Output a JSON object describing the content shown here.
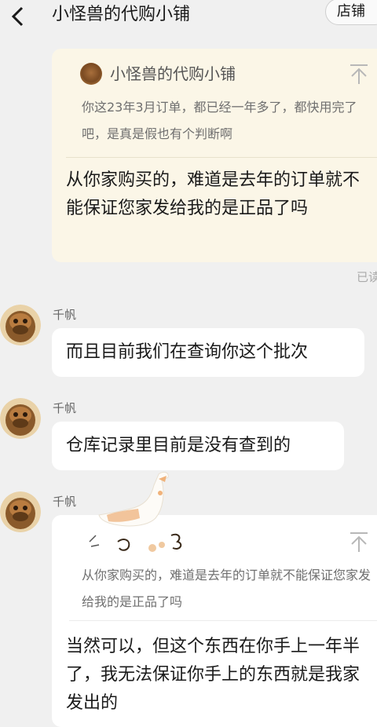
{
  "header": {
    "back_icon": "chevron-left-icon",
    "title": "小怪兽的代购小铺",
    "shop_button": "店铺"
  },
  "messages": [
    {
      "side": "right",
      "quote_name": "小怪兽的代购小铺",
      "quote_text": "你这23年3月订单，都已经一年多了，都快用完了吧，是真是假也有个判断啊",
      "text": "从你家购买的，难道是去年的订单就不能保证您家发给我的是正品了吗",
      "status": "已读"
    },
    {
      "side": "left",
      "sender": "千帆",
      "text": "而且目前我们在查询你这个批次"
    },
    {
      "side": "left",
      "sender": "千帆",
      "text": "仓库记录里目前是没有查到的"
    },
    {
      "side": "left",
      "sender": "千帆",
      "quote_text": "从你家购买的，难道是去年的订单就不能保证您家发给我的是正品了吗",
      "text": "当然可以，但这个东西在你手上一年半了，我无法保证你手上的东西就是我家发出的"
    }
  ],
  "colors": {
    "background": "#f0f0f0",
    "mine_bubble": "#fbf6e7",
    "their_bubble": "#ffffff"
  }
}
